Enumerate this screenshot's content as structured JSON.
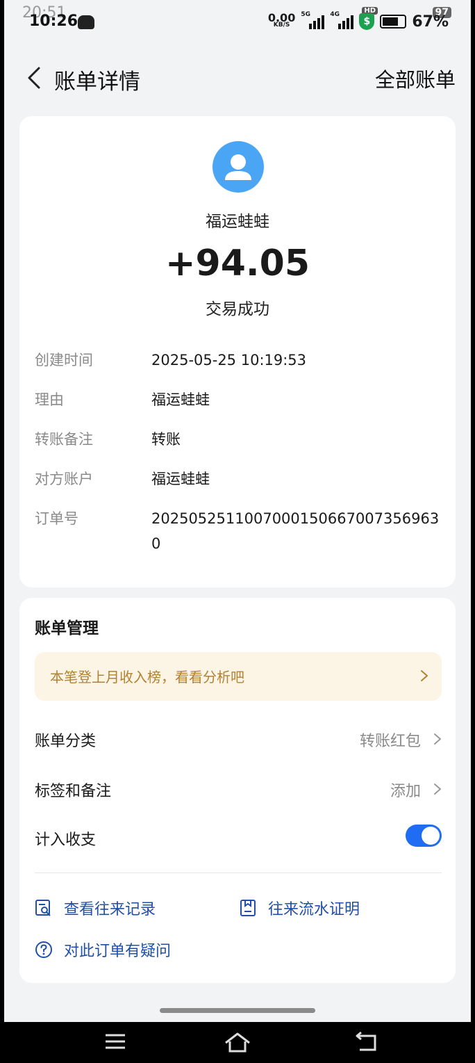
{
  "status_bar": {
    "time_ghost": "20:51",
    "time": "10:26",
    "net_speed_value": "0.00",
    "net_speed_unit": "KB/S",
    "sig1_tag": "5G",
    "sig2_tag": "4G",
    "sig3_tag": "5G",
    "hd_tag": "HD",
    "shield_glyph": "$",
    "battery_pct": "67%",
    "wifi_badge": "97",
    "icons": [
      "network-speed",
      "signal-5g",
      "signal-4g",
      "shield-icon",
      "battery-icon",
      "wifi-icon"
    ]
  },
  "nav": {
    "title": "账单详情",
    "all_bills": "全部账单"
  },
  "transaction": {
    "payee": "福运蛙蛙",
    "amount": "+94.05",
    "status": "交易成功",
    "accent_color": "#4aa6f5"
  },
  "details": [
    {
      "label": "创建时间",
      "value": "2025-05-25 10:19:53"
    },
    {
      "label": "理由",
      "value": "福运蛙蛙"
    },
    {
      "label": "转账备注",
      "value": "转账"
    },
    {
      "label": "对方账户",
      "value": "福运蛙蛙"
    },
    {
      "label": "订单号",
      "value": "20250525110070001506670073569630"
    }
  ],
  "manage": {
    "title": "账单管理",
    "banner": "本笔登上月收入榜，看看分析吧",
    "category_label": "账单分类",
    "category_value": "转账红包",
    "tags_label": "标签和备注",
    "tags_value": "添加",
    "include_label": "计入收支",
    "include_on": true,
    "toggle_color": "#1f6df2",
    "link_history": "查看往来记录",
    "link_proof": "往来流水证明",
    "link_question": "对此订单有疑问"
  }
}
